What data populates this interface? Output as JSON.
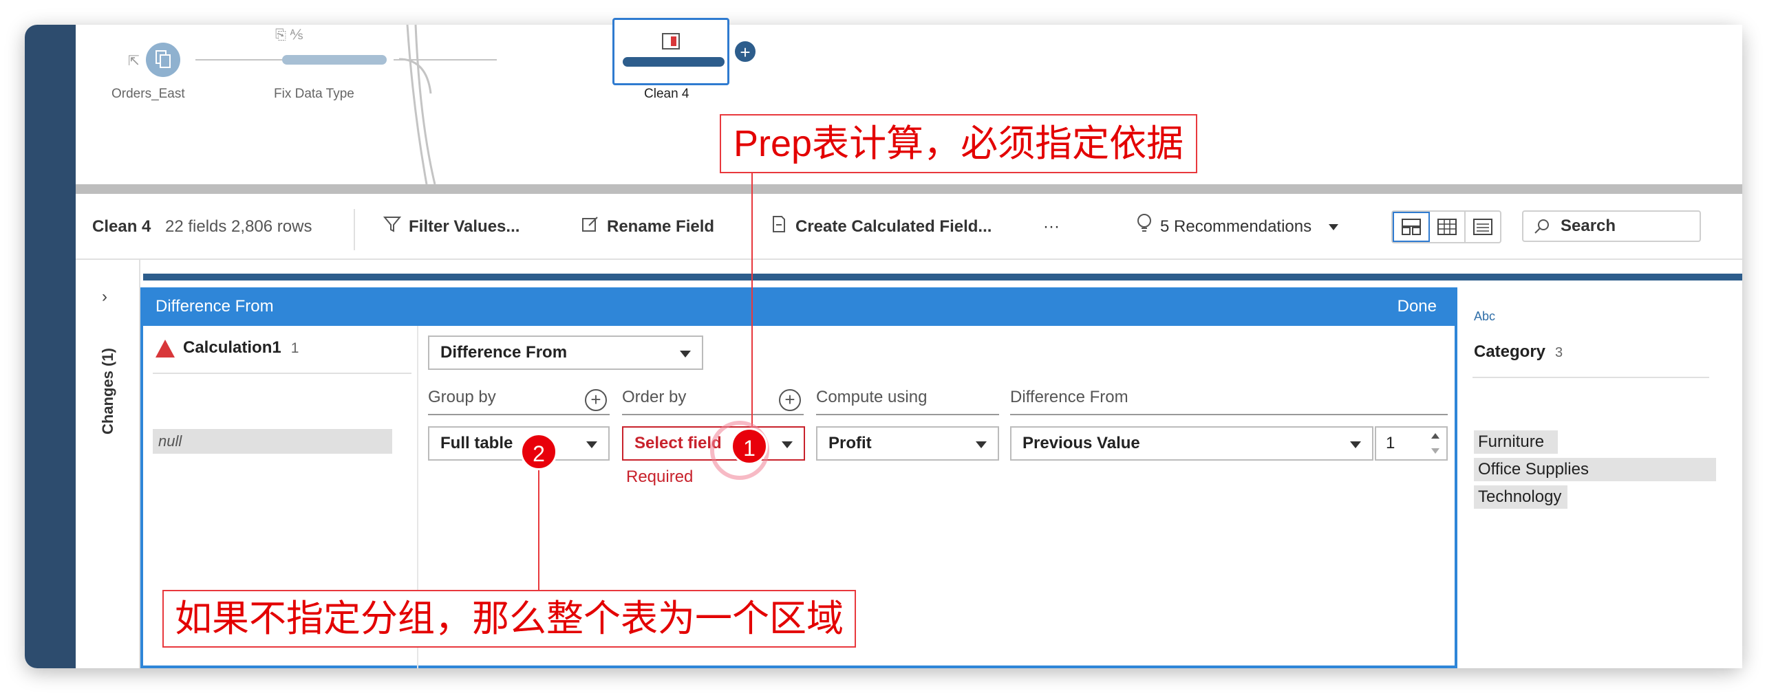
{
  "flow": {
    "nodes": [
      {
        "label": "Orders_East"
      },
      {
        "label": "Fix Data Type"
      },
      {
        "label": "Clean 4"
      }
    ]
  },
  "toolbar": {
    "step_name": "Clean 4",
    "stats": "22 fields  2,806 rows",
    "filter_label": "Filter Values...",
    "rename_label": "Rename Field",
    "calc_label": "Create Calculated Field...",
    "more_label": "···",
    "recommendations_label": "5 Recommendations",
    "search_label": "Search"
  },
  "changes_panel": {
    "label": "Changes (1)"
  },
  "editor": {
    "title": "Difference From",
    "done_label": "Done",
    "field_name": "Calculation1",
    "field_count": "1",
    "null_value": "null",
    "calc_type": "Difference From",
    "columns": {
      "group_by": "Group by",
      "order_by": "Order by",
      "compute_using": "Compute using",
      "difference_from": "Difference From"
    },
    "group_by_value": "Full table",
    "order_by_value": "Select field",
    "required_text": "Required",
    "compute_using_value": "Profit",
    "difference_value": "Previous Value",
    "offset_value": "1"
  },
  "profile": {
    "type_label": "Abc",
    "field_name": "Category",
    "count": "3",
    "values": [
      "Furniture",
      "Office Supplies",
      "Technology"
    ]
  },
  "annotations": {
    "top_note": "Prep表计算，必须指定依据",
    "bottom_note": "如果不指定分组，那么整个表为一个区域",
    "badge1": "1",
    "badge2": "2"
  },
  "colors": {
    "accent_blue": "#2f86d8",
    "dark_sidebar": "#2d4c6e",
    "error_red": "#c8222c",
    "annotation_red": "#e30000"
  }
}
